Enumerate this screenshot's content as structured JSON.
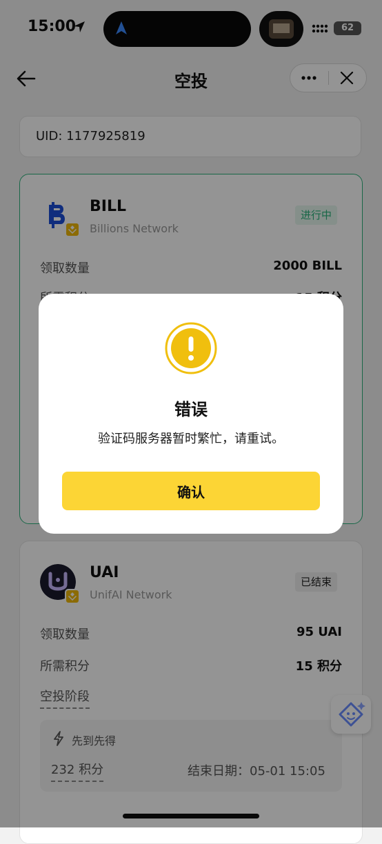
{
  "status_bar": {
    "time": "15:00",
    "battery": "62"
  },
  "nav": {
    "title": "空投"
  },
  "uid": {
    "text": "UID: 1177925819"
  },
  "cards": [
    {
      "symbol": "BILL",
      "network": "Billions Network",
      "status": "进行中",
      "rows": [
        {
          "label": "领取数量",
          "value": "2000 BILL"
        },
        {
          "label": "所需积分",
          "value": "15 积分"
        }
      ]
    },
    {
      "symbol": "UAI",
      "network": "UnifAI Network",
      "status": "已结束",
      "rows": [
        {
          "label": "领取数量",
          "value": "95 UAI"
        },
        {
          "label": "所需积分",
          "value": "15 积分"
        }
      ],
      "phase_title": "空投阶段",
      "phase": {
        "label": "先到先得",
        "points": "232 积分",
        "end": "结束日期：05-01 15:05"
      }
    }
  ],
  "modal": {
    "title": "错误",
    "message": "验证码服务器暂时繁忙，请重试。",
    "confirm_label": "确认"
  },
  "colors": {
    "accent_green": "#2ab27b",
    "brand_yellow": "#fcd535",
    "bnb_yellow": "#f0b90b",
    "warning_yellow": "#f0bf0e"
  }
}
